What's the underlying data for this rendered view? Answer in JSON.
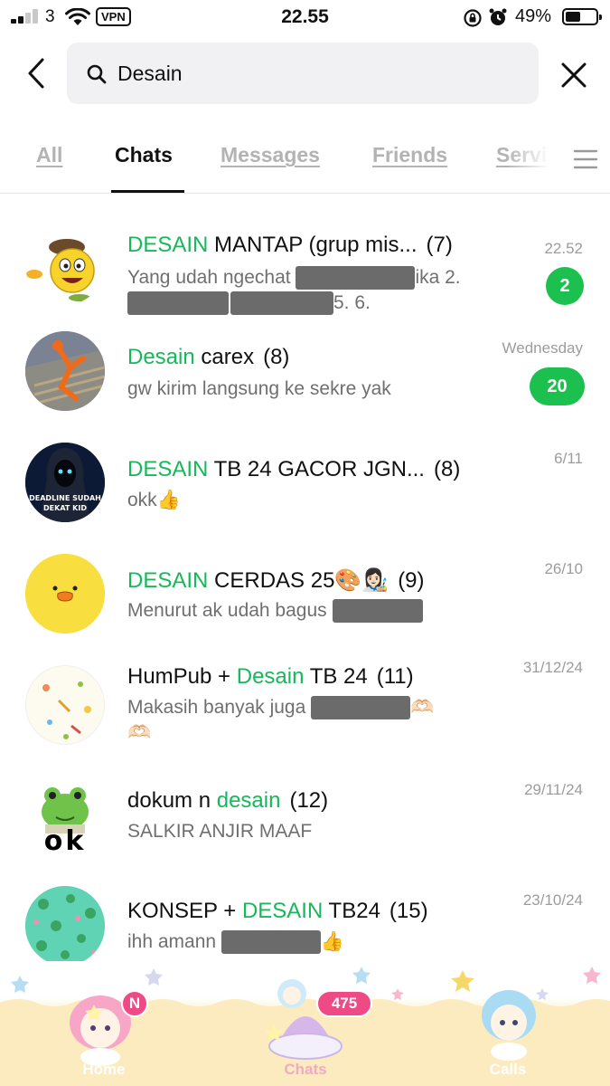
{
  "status_bar": {
    "carrier": "3",
    "vpn": "VPN",
    "time": "22.55",
    "battery_percent": "49%",
    "battery_level": 0.49,
    "signal_bars": 2
  },
  "search": {
    "value": "Desain",
    "back_icon": "chevron-left-icon",
    "search_icon": "magnifier-icon",
    "clear_icon": "close-icon"
  },
  "tabs": [
    {
      "label": "All",
      "active": false
    },
    {
      "label": "Chats",
      "active": true
    },
    {
      "label": "Messages",
      "active": false
    },
    {
      "label": "Friends",
      "active": false
    },
    {
      "label": "Servi",
      "active": false
    }
  ],
  "chats": [
    {
      "title_pre": "",
      "title_hl": "DESAIN",
      "title_post": " MANTAP (grup mis...",
      "count": "(7)",
      "preview_a": "Yang udah ngechat",
      "preview_b": "ika 2.",
      "preview_c": "5. 6.",
      "date": "22.52",
      "unread": "2",
      "avatar_icon": "smiley-painter-icon"
    },
    {
      "title_pre": "",
      "title_hl": "Desain",
      "title_post": " carex",
      "count": "(8)",
      "preview": "gw kirim langsung ke sekre yak",
      "date": "Wednesday",
      "unread": "20",
      "avatar_icon": "photo-icon"
    },
    {
      "title_pre": "",
      "title_hl": "DESAIN",
      "title_post": " TB 24 GACOR JGN...",
      "count": "(8)",
      "preview": "okk👍",
      "date": "6/11",
      "avatar_icon": "grim-reaper-icon",
      "avatar_text_1": "DEADLINE SUDAH",
      "avatar_text_2": "DEKAT KID"
    },
    {
      "title_pre": "",
      "title_hl": "DESAIN",
      "title_post": " CERDAS 25🎨👩🏻‍🎨",
      "count": "(9)",
      "preview": "Menurut ak udah bagus",
      "date": "26/10",
      "avatar_icon": "duck-icon"
    },
    {
      "title_pre": "HumPub + ",
      "title_hl": "Desain",
      "title_post": " TB 24",
      "count": "(11)",
      "preview": "Makasih banyak juga",
      "preview_tail": "🫶🏻",
      "preview_line2": "🫶🏻",
      "date": "31/12/24",
      "avatar_icon": "doodle-pattern-icon"
    },
    {
      "title_pre": "dokum n ",
      "title_hl": "desain",
      "title_post": "",
      "count": "(12)",
      "preview": "SALKIR ANJIR MAAF",
      "date": "29/11/24",
      "avatar_icon": "frog-icon",
      "avatar_text": "ok"
    },
    {
      "title_pre": "KONSEP + ",
      "title_hl": "DESAIN",
      "title_post": " TB24",
      "count": "(15)",
      "preview": "ihh amann",
      "preview_tail": "👍",
      "date": "23/10/24",
      "avatar_icon": "watermelon-pattern-icon"
    }
  ],
  "bottom_nav": {
    "items": [
      {
        "label": "Home",
        "icon": "little-twin-star-girl-icon",
        "badge": "N"
      },
      {
        "label": "Chats",
        "icon": "jelly-cloud-icon",
        "badge": "475",
        "active": true
      },
      {
        "label": "Calls",
        "icon": "little-twin-star-boy-icon"
      }
    ]
  },
  "colors": {
    "highlight": "#16b85a",
    "badge": "#1cc04f",
    "nav_badge": "#ee4a86"
  }
}
